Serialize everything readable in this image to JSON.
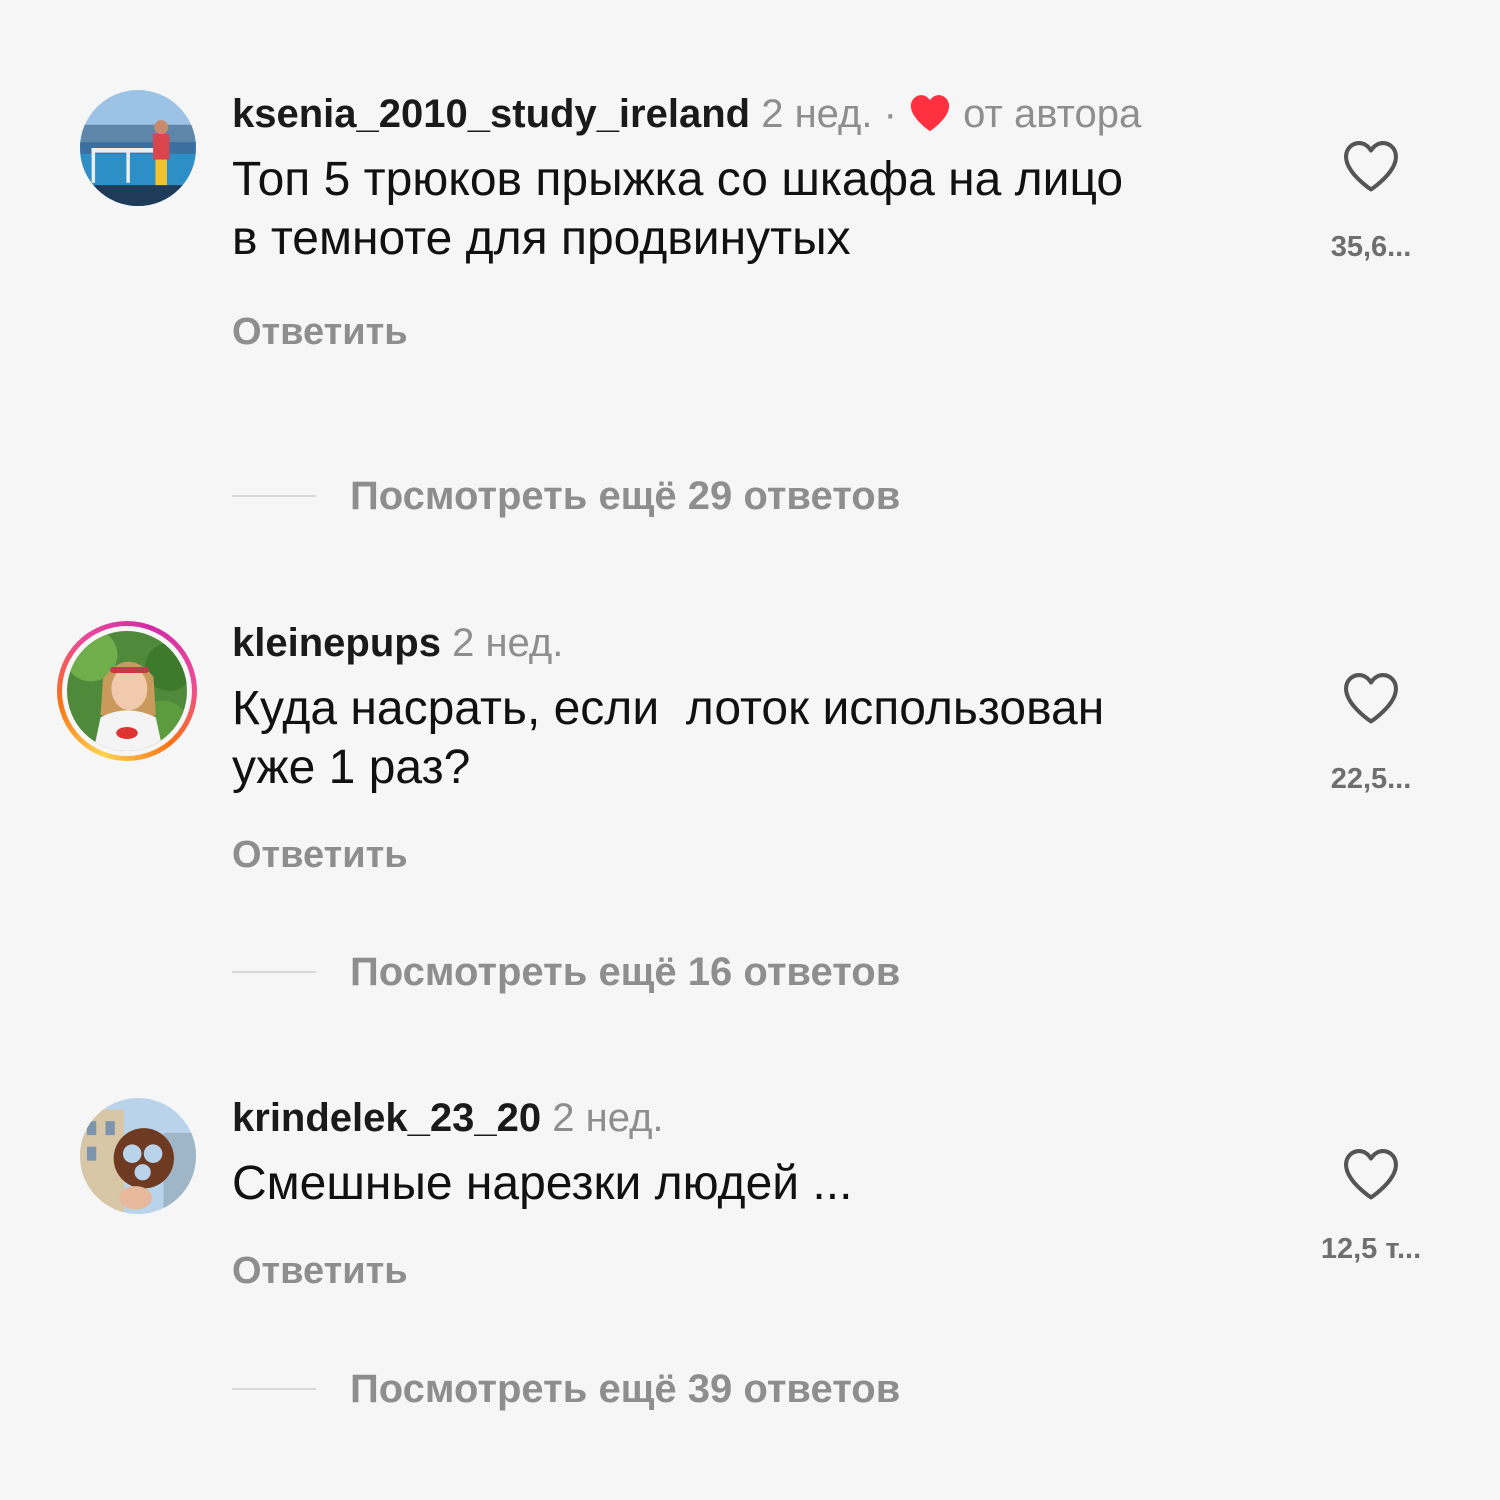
{
  "comments": [
    {
      "username": "ksenia_2010_study_ireland",
      "time": "2 нед.",
      "separator": " · ",
      "author_badge": "от автора",
      "text": "Топ 5 трюков прыжка со шкафа на лицо\nв темноте для продвинутых",
      "reply_label": "Ответить",
      "view_more_label": "Посмотреть ещё 29 ответов",
      "like_count": "35,6..."
    },
    {
      "username": "kleinepups",
      "time": "2 нед.",
      "text": "Куда насрать, если  лоток использован\nуже 1 раз?",
      "reply_label": "Ответить",
      "view_more_label": "Посмотреть ещё 16 ответов",
      "like_count": "22,5..."
    },
    {
      "username": "krindelek_23_20",
      "time": "2 нед.",
      "text": "Смешные нарезки людей ...",
      "reply_label": "Ответить",
      "view_more_label": "Посмотреть ещё 39 ответов",
      "like_count": "12,5 т..."
    }
  ],
  "colors": {
    "background": "#f6f6f6",
    "muted_text": "#8e8e8e",
    "heart_red": "#ff3040",
    "story_ring": [
      "#fcd34d",
      "#f97316",
      "#ec4899"
    ]
  },
  "icons": {
    "author_like": "heart-filled-icon",
    "like": "heart-outline-icon"
  }
}
